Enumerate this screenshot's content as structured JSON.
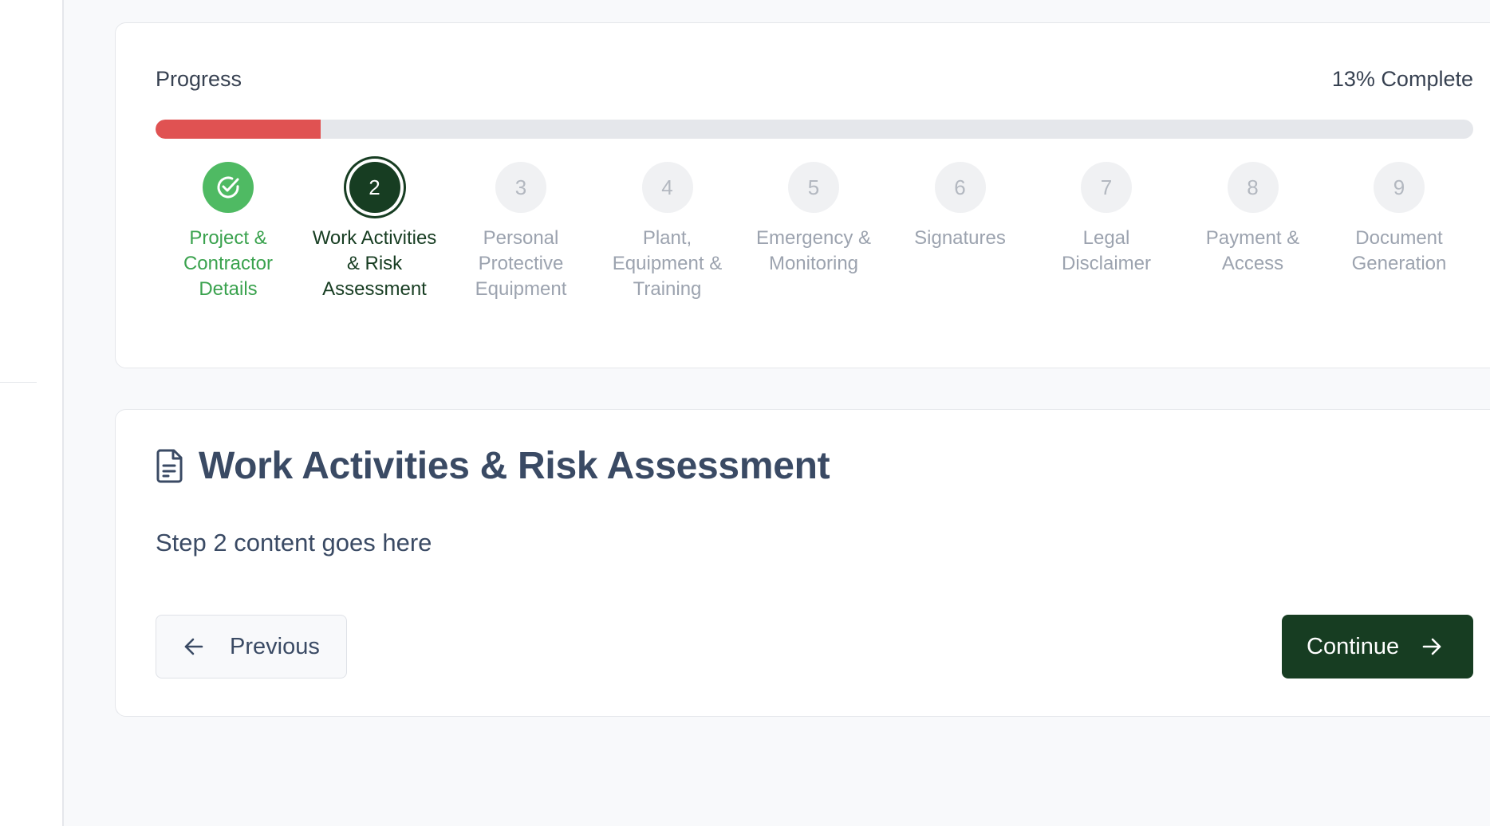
{
  "progress": {
    "label": "Progress",
    "percent_text": "13% Complete",
    "percent": 0.125
  },
  "steps": [
    {
      "number": "1",
      "label": "Project & Contractor Details",
      "state": "done"
    },
    {
      "number": "2",
      "label": "Work Activities & Risk Assessment",
      "state": "current"
    },
    {
      "number": "3",
      "label": "Personal Protective Equipment",
      "state": "upcoming"
    },
    {
      "number": "4",
      "label": "Plant, Equipment & Training",
      "state": "upcoming"
    },
    {
      "number": "5",
      "label": "Emergency & Monitoring",
      "state": "upcoming"
    },
    {
      "number": "6",
      "label": "Signatures",
      "state": "upcoming"
    },
    {
      "number": "7",
      "label": "Legal Disclaimer",
      "state": "upcoming"
    },
    {
      "number": "8",
      "label": "Payment & Access",
      "state": "upcoming"
    },
    {
      "number": "9",
      "label": "Document Generation",
      "state": "upcoming"
    }
  ],
  "section": {
    "icon": "document-icon",
    "title": "Work Activities & Risk Assessment",
    "content": "Step 2 content goes here"
  },
  "nav": {
    "previous_label": "Previous",
    "previous_icon": "arrow-left-icon",
    "continue_label": "Continue",
    "continue_icon": "arrow-right-icon"
  },
  "colors": {
    "progress_fill": "#e05252",
    "done": "#4fba63",
    "current": "#173d22",
    "accent_button": "#173d22"
  }
}
